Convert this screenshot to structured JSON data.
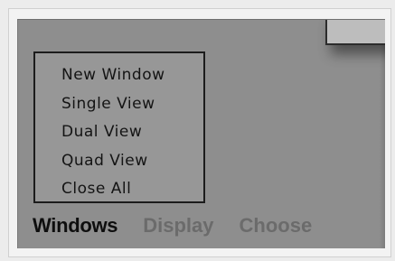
{
  "menu_bar": {
    "items": [
      {
        "label": "Windows",
        "state": "active"
      },
      {
        "label": "Display",
        "state": "inactive"
      },
      {
        "label": "Choose",
        "state": "inactive"
      }
    ]
  },
  "windows_menu": {
    "items": [
      {
        "label": "New Window"
      },
      {
        "label": "Single View"
      },
      {
        "label": "Dual View"
      },
      {
        "label": "Quad View"
      },
      {
        "label": "Close All"
      }
    ]
  },
  "colors": {
    "background": "#8e8e8e",
    "menu_panel": "#979797",
    "active_text": "#0e0e0e",
    "inactive_text": "#6b6b6b",
    "border": "#1c1c1c"
  }
}
